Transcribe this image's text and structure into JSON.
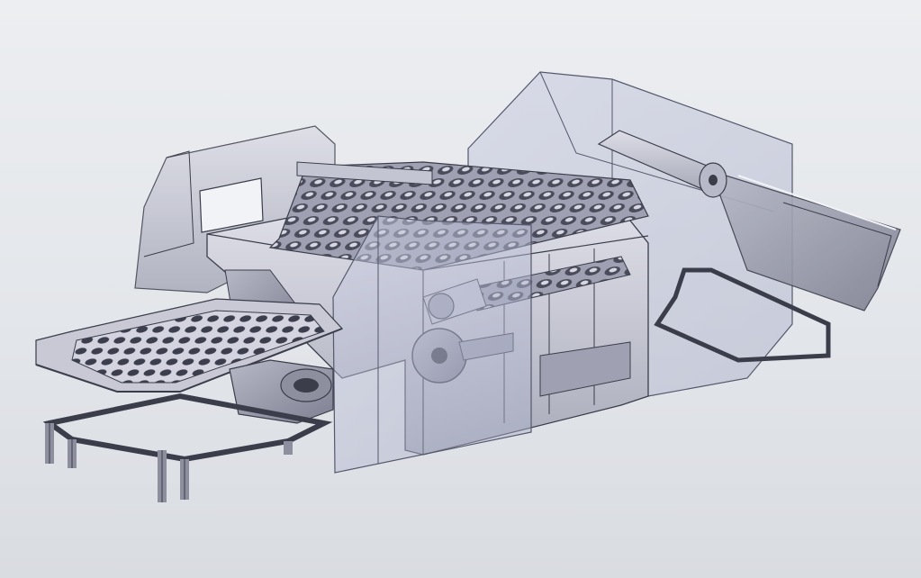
{
  "viewport": {
    "colors": {
      "background_top": "#eceef1",
      "background_bottom": "#d9dce1",
      "machine_metal": "#c9cad6",
      "machine_shadow": "#8d8f9e",
      "machine_edge": "#3b3d4a",
      "transparent_guard": "#b4b8cf"
    }
  },
  "model": {
    "parts": [
      {
        "name": "rear-housing-left",
        "kind": "housing"
      },
      {
        "name": "transparent-top-guard",
        "kind": "guard"
      },
      {
        "name": "output-chute",
        "kind": "chute"
      },
      {
        "name": "main-frame",
        "kind": "frame"
      },
      {
        "name": "roller-bed",
        "kind": "rollers"
      },
      {
        "name": "perforated-feed-tray",
        "kind": "tray"
      },
      {
        "name": "drive-wheel",
        "kind": "wheel"
      },
      {
        "name": "motor",
        "kind": "motor"
      },
      {
        "name": "support-stand",
        "kind": "stand"
      },
      {
        "name": "front-transparent-cover",
        "kind": "guard"
      }
    ]
  }
}
